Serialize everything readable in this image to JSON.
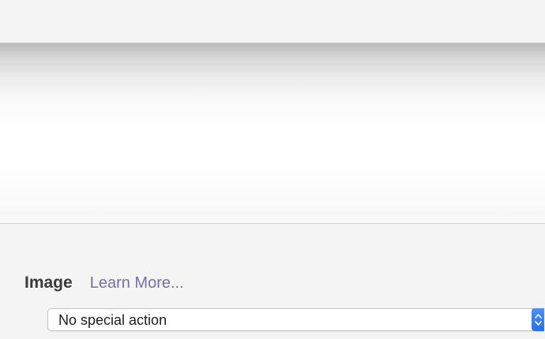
{
  "section": {
    "title": "Image",
    "learn_more": "Learn More..."
  },
  "action_popup": {
    "selected": "No special action",
    "stepper_icon": "chevron-up-down-icon"
  },
  "colors": {
    "accent": "#2f74ec",
    "link": "#7a6fa0"
  }
}
